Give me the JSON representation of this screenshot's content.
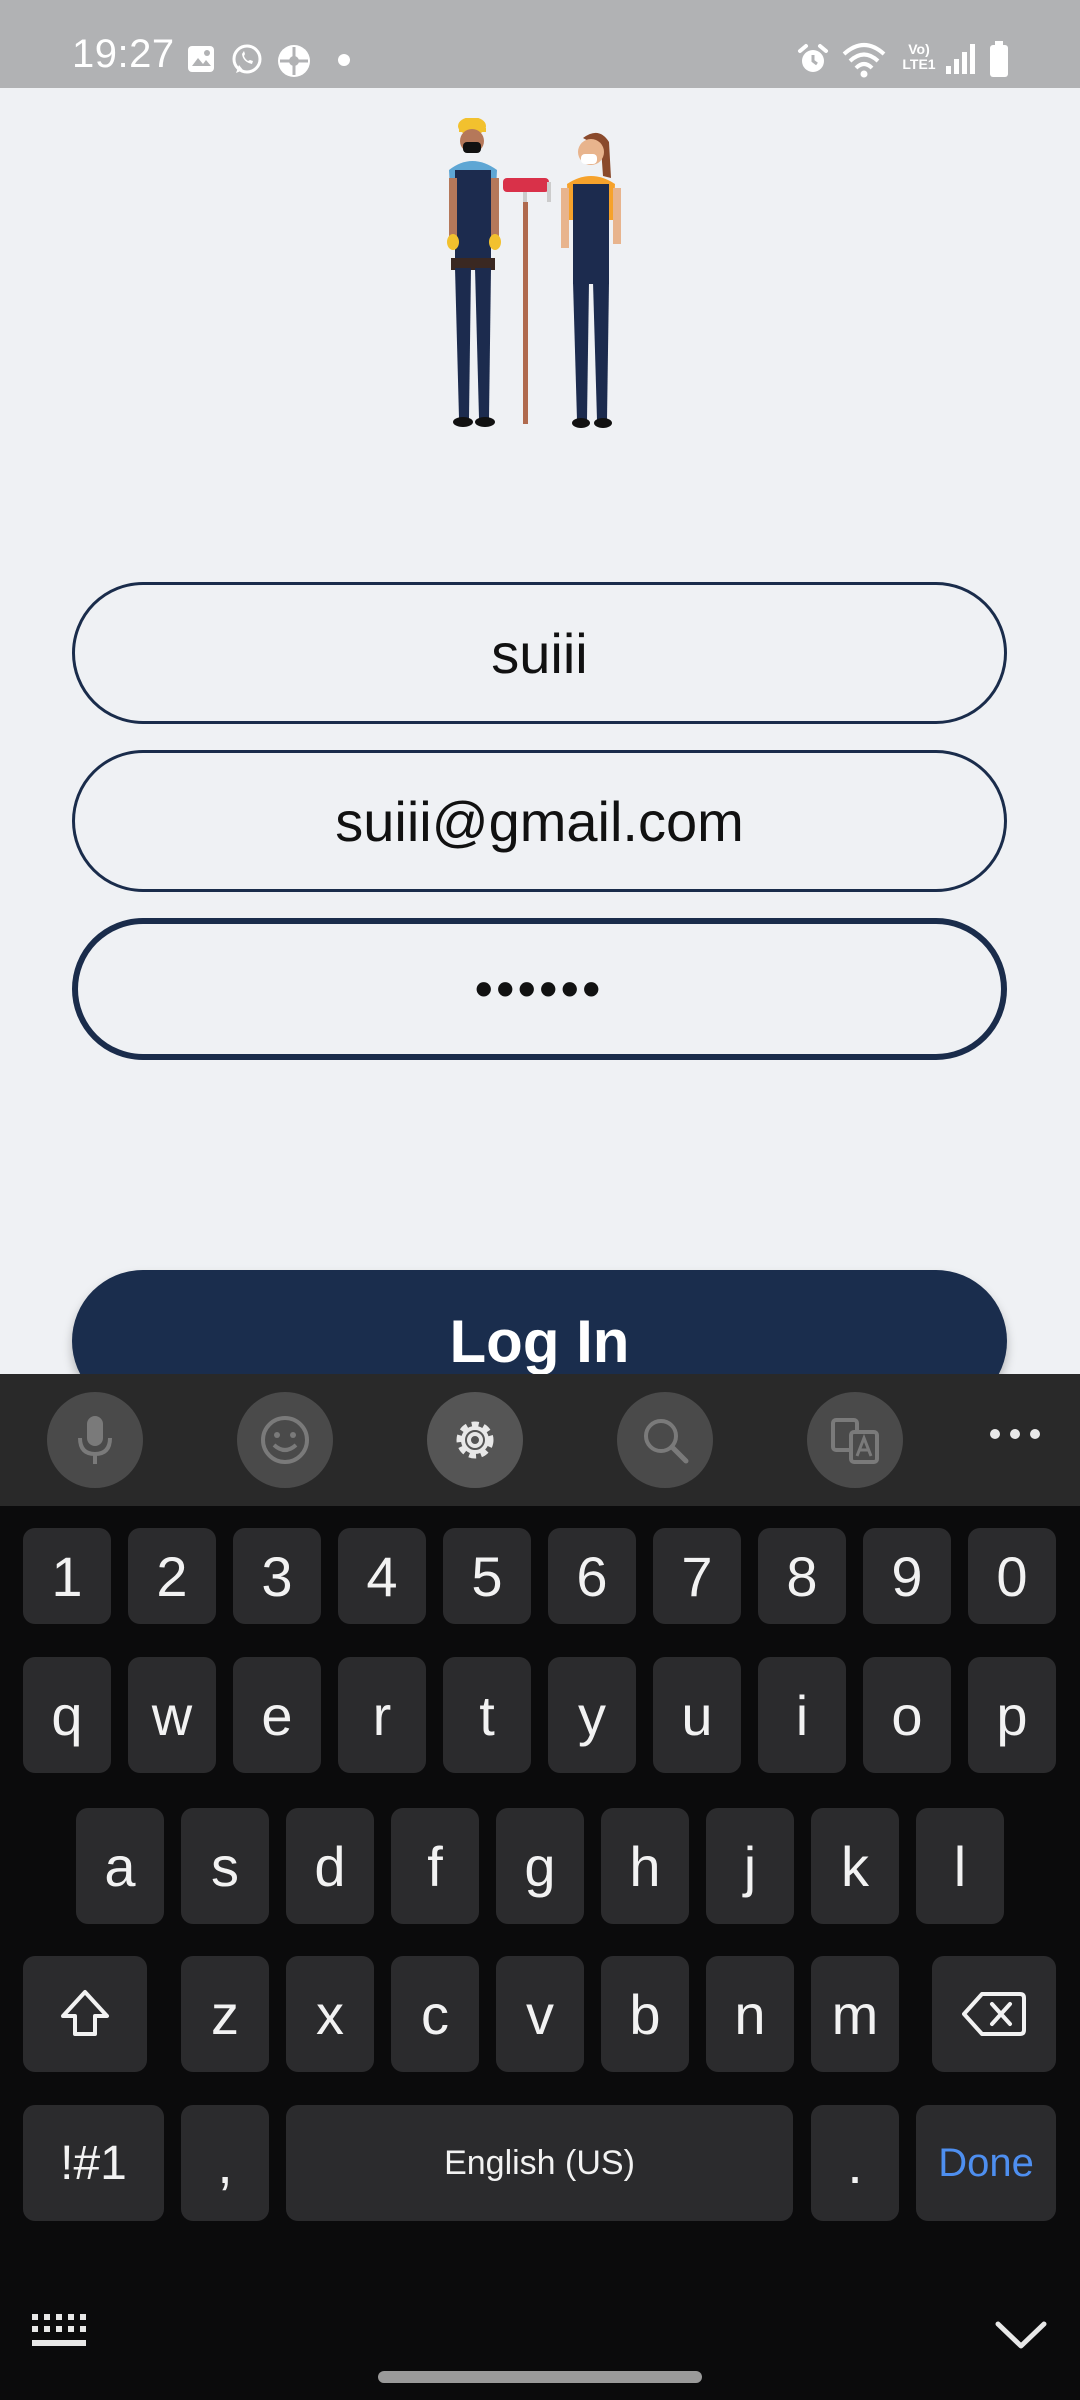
{
  "status_bar": {
    "time": "19:27",
    "left_icons": [
      "gallery-icon",
      "whatsapp-icon",
      "app-icon",
      "dot-icon"
    ],
    "right_icons": [
      "alarm-icon",
      "wifi-icon",
      "volte-icon",
      "signal-icon",
      "battery-icon"
    ],
    "volte_label": "Vo) LTE1"
  },
  "form": {
    "name_value": "suiii",
    "email_value": "suiii@gmail.com",
    "password_masked": "••••••",
    "login_label": "Log In"
  },
  "keyboard": {
    "toolbar": [
      "mic-icon",
      "emoji-icon",
      "settings-icon",
      "search-icon",
      "translate-icon",
      "more-icon"
    ],
    "row_numbers": [
      "1",
      "2",
      "3",
      "4",
      "5",
      "6",
      "7",
      "8",
      "9",
      "0"
    ],
    "row_top": [
      "q",
      "w",
      "e",
      "r",
      "t",
      "y",
      "u",
      "i",
      "o",
      "p"
    ],
    "row_middle": [
      "a",
      "s",
      "d",
      "f",
      "g",
      "h",
      "j",
      "k",
      "l"
    ],
    "row_bottom": [
      "z",
      "x",
      "c",
      "v",
      "b",
      "n",
      "m"
    ],
    "symbols_label": "!#1",
    "comma_label": ",",
    "space_label": "English (US)",
    "period_label": ".",
    "done_label": "Done"
  },
  "colors": {
    "primary": "#1a2d4d",
    "background": "#eff1f4",
    "keyboard_bg": "#0b0b0c",
    "key_bg": "#2b2b2d",
    "done_accent": "#4e8ff0"
  }
}
